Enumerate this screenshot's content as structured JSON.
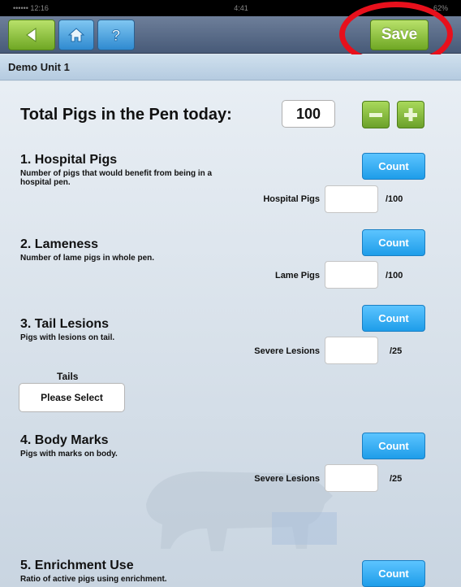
{
  "statusbar": {
    "left": "•••••• 12:16",
    "center": "4:41",
    "right": "62%"
  },
  "navbar": {
    "back_icon": "back-arrow-icon",
    "home_icon": "home-icon",
    "help_icon": "question-mark-icon",
    "save_label": "Save"
  },
  "unit": {
    "name": "Demo Unit 1"
  },
  "total": {
    "label": "Total Pigs in the Pen today:",
    "value": "100"
  },
  "sections": [
    {
      "title": "1. Hospital Pigs",
      "description": "Number of pigs that would benefit from being in a hospital pen.",
      "count_label": "Count",
      "field_label": "Hospital Pigs",
      "field_value": "",
      "field_suffix": "/100"
    },
    {
      "title": "2. Lameness",
      "description": "Number of lame pigs in whole pen.",
      "count_label": "Count",
      "field_label": "Lame Pigs",
      "field_value": "",
      "field_suffix": "/100"
    },
    {
      "title": "3. Tail Lesions",
      "description": "Pigs with lesions on tail.",
      "count_label": "Count",
      "field_label": "Severe Lesions",
      "field_value": "",
      "field_suffix": "/25",
      "select_label": "Tails",
      "select_value": "Please Select"
    },
    {
      "title": "4. Body Marks",
      "description": "Pigs with marks on body.",
      "count_label": "Count",
      "field_label": "Severe Lesions",
      "field_value": "",
      "field_suffix": "/25"
    },
    {
      "title": "5. Enrichment Use",
      "description": "Ratio of active pigs using enrichment.",
      "count_label": "Count"
    }
  ],
  "colors": {
    "save_green": "#8cc63f",
    "count_blue": "#2aa8f2",
    "highlight_red": "#e8101c"
  }
}
